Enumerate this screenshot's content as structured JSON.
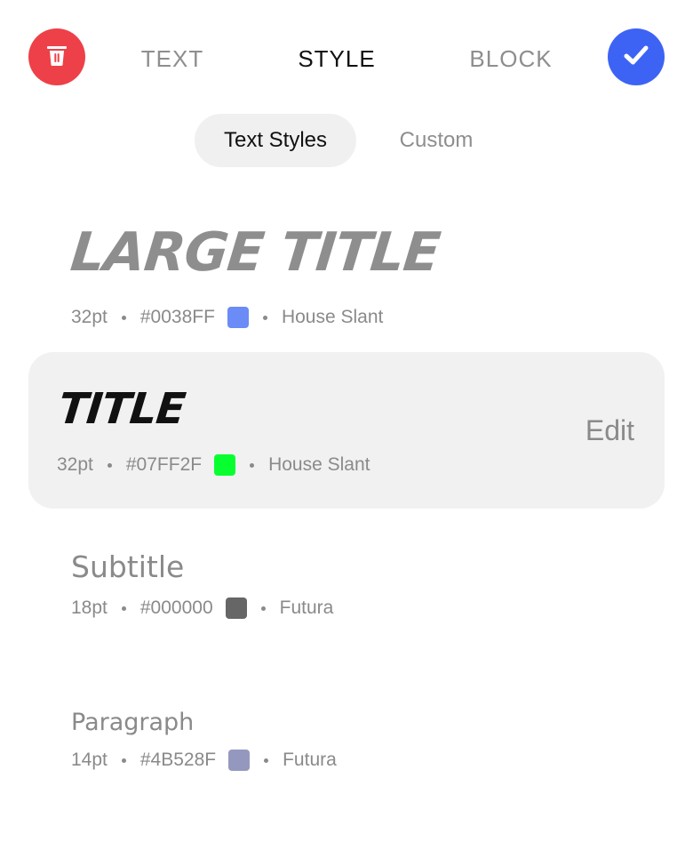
{
  "toolbar": {
    "delete_icon": "trash-icon",
    "confirm_icon": "checkmark-icon",
    "tabs": [
      {
        "label": "TEXT",
        "active": false
      },
      {
        "label": "STYLE",
        "active": true
      },
      {
        "label": "BLOCK",
        "active": false
      }
    ],
    "colors": {
      "delete": "#EE4048",
      "confirm": "#3D63F5"
    }
  },
  "segments": {
    "items": [
      {
        "label": "Text Styles",
        "selected": true
      },
      {
        "label": "Custom",
        "selected": false
      }
    ]
  },
  "styles": [
    {
      "sample": "Large Title",
      "size": "32pt",
      "color": "#0038FF",
      "swatch": "#6B8BF7",
      "font": "House Slant",
      "selected": false
    },
    {
      "sample": "Title",
      "size": "32pt",
      "color": "#07FF2F",
      "swatch": "#07FF2F",
      "font": "House Slant",
      "selected": true,
      "edit_label": "Edit"
    },
    {
      "sample": "Subtitle",
      "size": "18pt",
      "color": "#000000",
      "swatch": "#666666",
      "font": "Futura",
      "selected": false
    },
    {
      "sample": "Paragraph",
      "size": "14pt",
      "color": "#4B528F",
      "swatch": "#9598BE",
      "font": "Futura",
      "selected": false
    }
  ]
}
